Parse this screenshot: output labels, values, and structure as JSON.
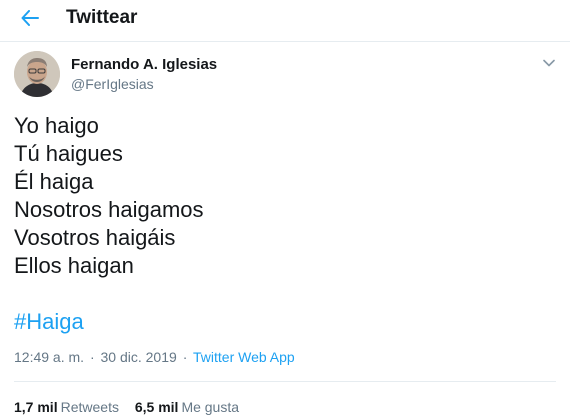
{
  "header": {
    "title": "Twittear",
    "back_icon": "arrow-left-icon",
    "accent_color": "#1da1f2"
  },
  "author": {
    "name": "Fernando A. Iglesias",
    "handle": "@FerIglesias",
    "more_icon": "chevron-down-icon"
  },
  "tweet": {
    "lines": [
      "Yo haigo",
      "Tú haigues",
      "Él haiga",
      "Nosotros haigamos",
      "Vosotros haigáis",
      "Ellos haigan"
    ],
    "hashtag": "#Haiga"
  },
  "meta": {
    "time": "12:49 a. m.",
    "separator": "·",
    "date": "30 dic. 2019",
    "source": "Twitter Web App"
  },
  "stats": {
    "retweets_value": "1,7 mil",
    "retweets_label": "Retweets",
    "likes_value": "6,5 mil",
    "likes_label": "Me gusta"
  }
}
